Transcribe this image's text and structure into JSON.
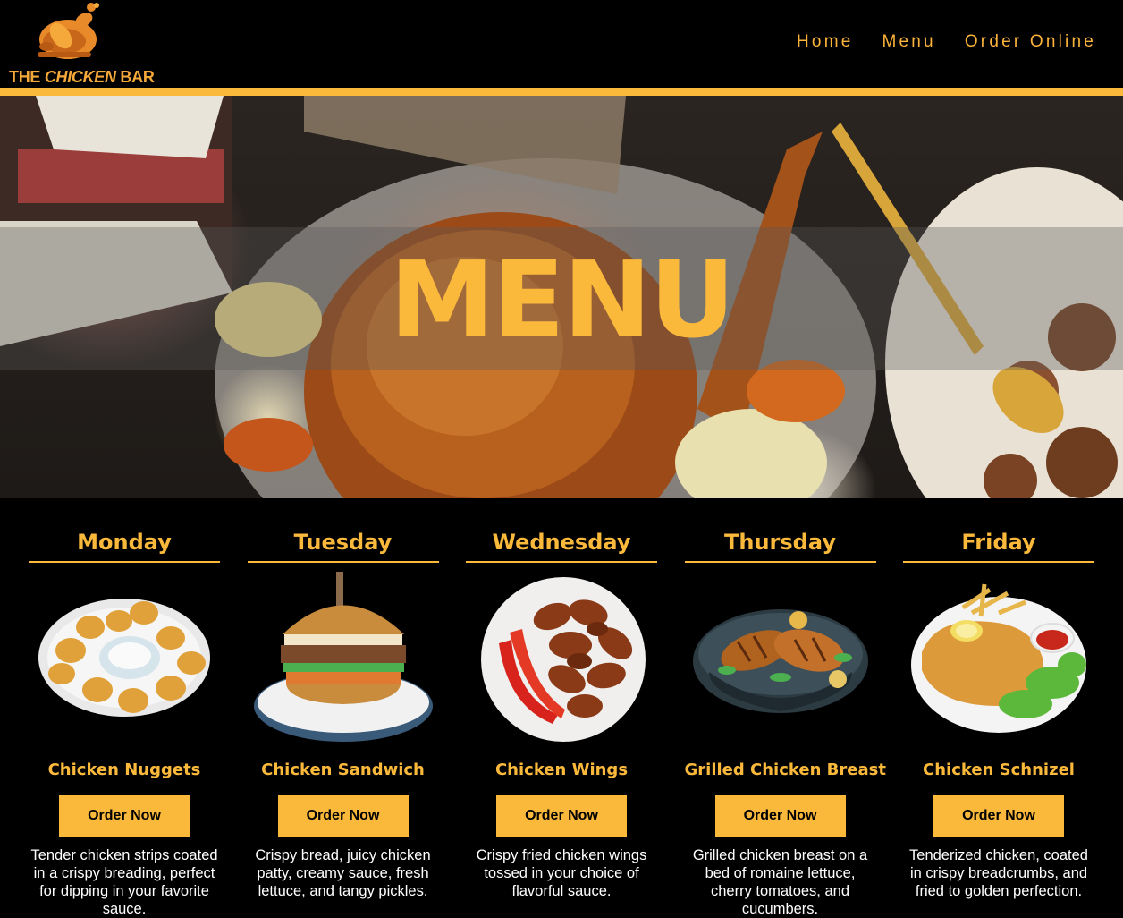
{
  "brand": {
    "logo_text_pre": "THE ",
    "logo_text_italic": "CHICKEN",
    "logo_text_post": " BAR"
  },
  "nav": {
    "items": [
      "Home",
      "Menu",
      "Order Online"
    ]
  },
  "hero": {
    "title": "MENU"
  },
  "menu": {
    "days": [
      {
        "day": "Monday",
        "dish": "Chicken Nuggets",
        "button": "Order Now",
        "description": "Tender chicken strips coated in a crispy breading, perfect for dipping in your favorite sauce."
      },
      {
        "day": "Tuesday",
        "dish": "Chicken Sandwich",
        "button": "Order Now",
        "description": "Crispy bread, juicy chicken patty, creamy sauce, fresh lettuce, and tangy pickles."
      },
      {
        "day": "Wednesday",
        "dish": "Chicken Wings",
        "button": "Order Now",
        "description": "Crispy fried chicken wings tossed in your choice of flavorful sauce."
      },
      {
        "day": "Thursday",
        "dish": "Grilled Chicken Breast",
        "button": "Order Now",
        "description": "Grilled chicken breast on a bed of romaine lettuce, cherry tomatoes, and cucumbers."
      },
      {
        "day": "Friday",
        "dish": "Chicken Schnizel",
        "button": "Order Now",
        "description": "Tenderized chicken, coated in crispy breadcrumbs, and fried to golden perfection."
      }
    ]
  },
  "colors": {
    "accent": "#fbb93c",
    "background": "#000000"
  }
}
